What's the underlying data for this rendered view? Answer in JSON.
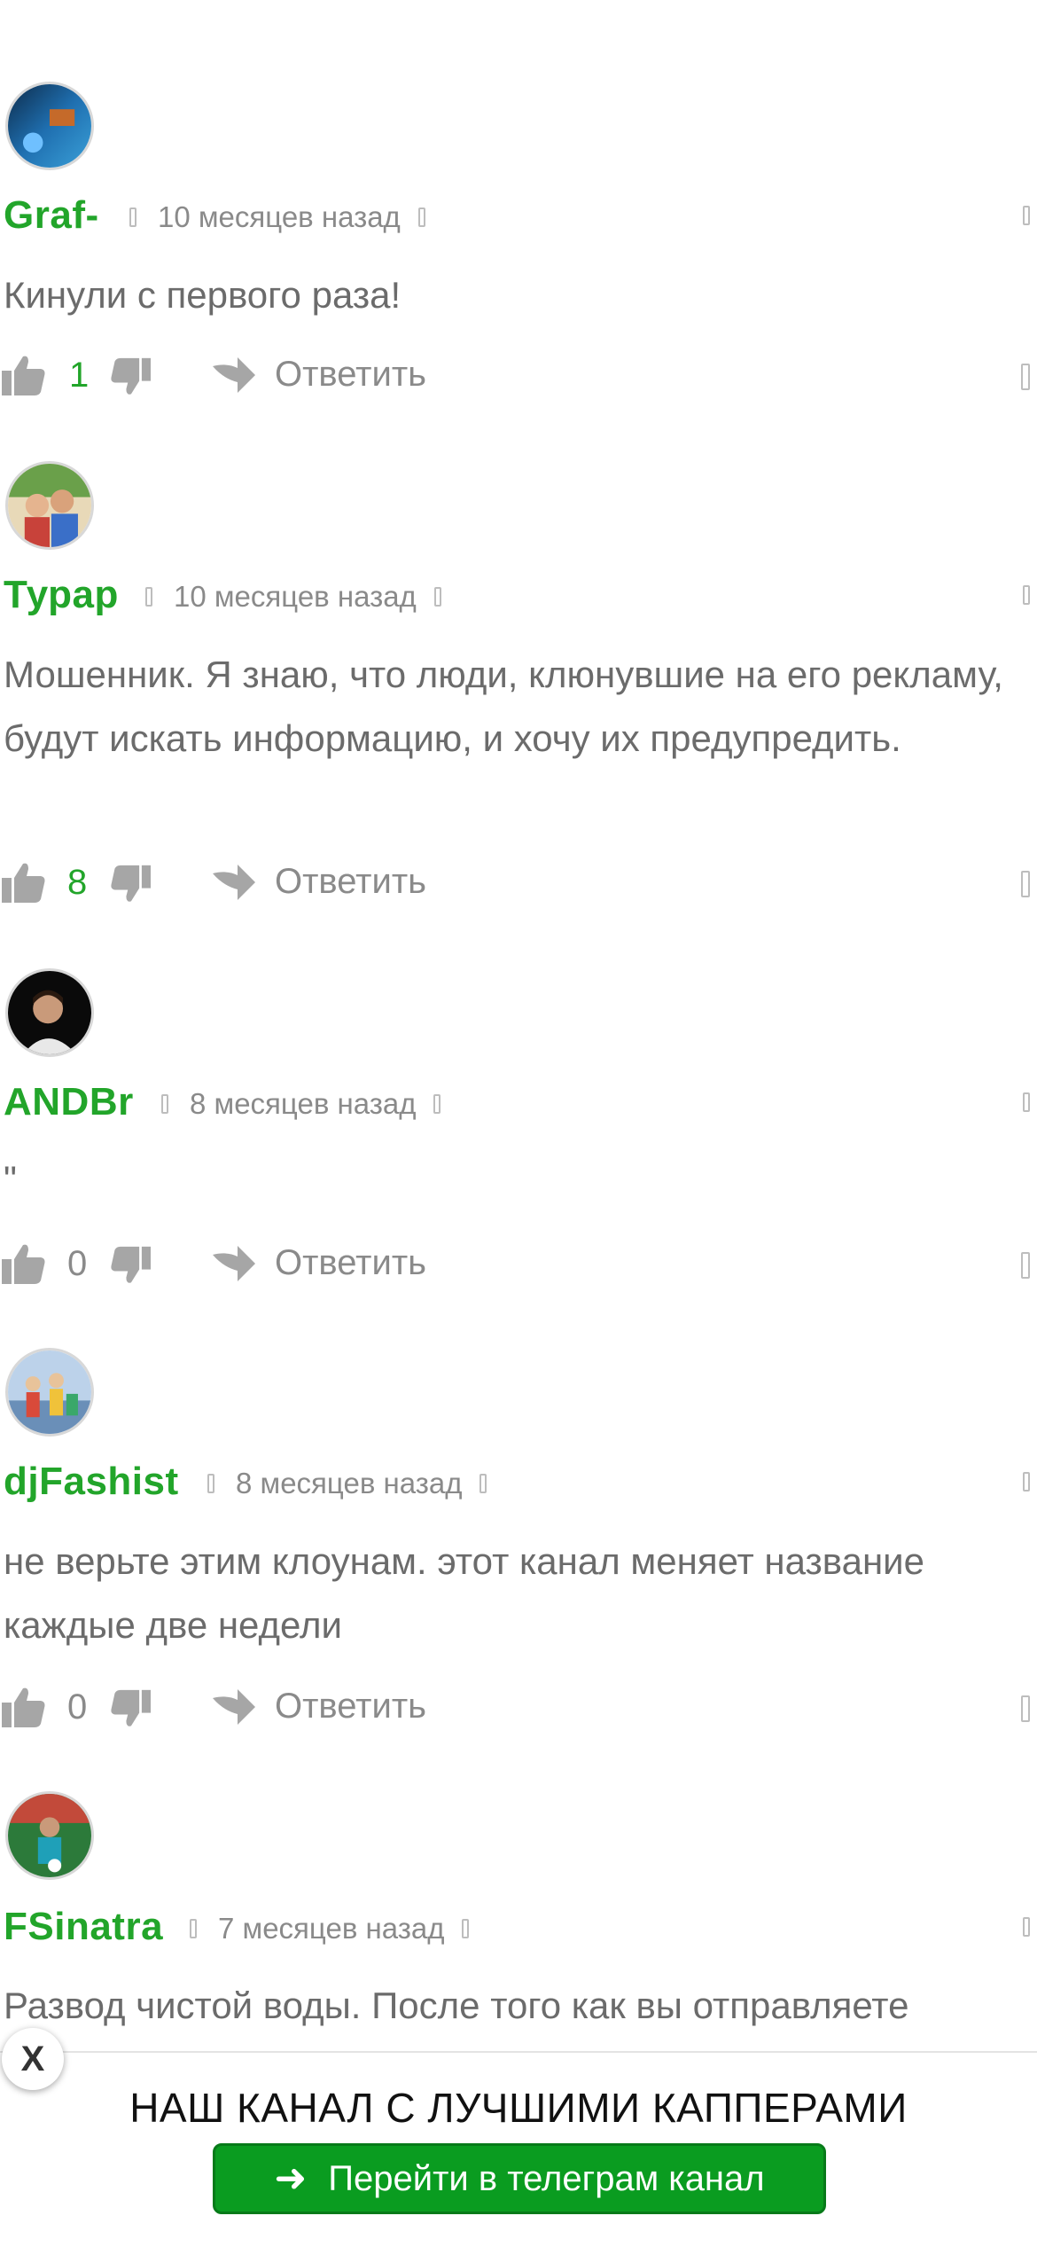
{
  "comments": [
    {
      "author": "Graf-",
      "time": "10 месяцев назад",
      "text": "Кинули с первого раза!",
      "likes": "1",
      "reply": "Ответить"
    },
    {
      "author": "Турар",
      "time": "10 месяцев назад",
      "text": "Мошенник. Я знаю, что люди, клюнувшие на его рекламу, будут искать информацию, и хочу их предупредить.",
      "likes": "8",
      "reply": "Ответить"
    },
    {
      "author": "ANDBr",
      "time": "8 месяцев назад",
      "text": "\"",
      "likes": "0",
      "reply": "Ответить"
    },
    {
      "author": "djFashist",
      "time": "8 месяцев назад",
      "text": "не верьте этим клоунам. этот канал меняет название каждые две недели",
      "likes": "0",
      "reply": "Ответить"
    },
    {
      "author": "FSinatra",
      "time": "7 месяцев назад",
      "text": "Развод чистой воды. После того как вы отправляете",
      "likes": "",
      "reply": ""
    }
  ],
  "banner": {
    "title": "НАШ КАНАЛ С ЛУЧШИМИ КАППЕРАМИ",
    "button_label": "Перейти в телеграм канал",
    "close_label": "X"
  },
  "colors": {
    "author": "#22a52a",
    "button": "#0a9c20",
    "text": "#6b6b6b",
    "muted": "#8a8a8a"
  },
  "icons": [
    "thumbs-up-icon",
    "thumbs-down-icon",
    "reply-arrow-icon",
    "clock-icon",
    "link-icon",
    "flag-icon",
    "more-icon",
    "arrow-right-icon"
  ]
}
